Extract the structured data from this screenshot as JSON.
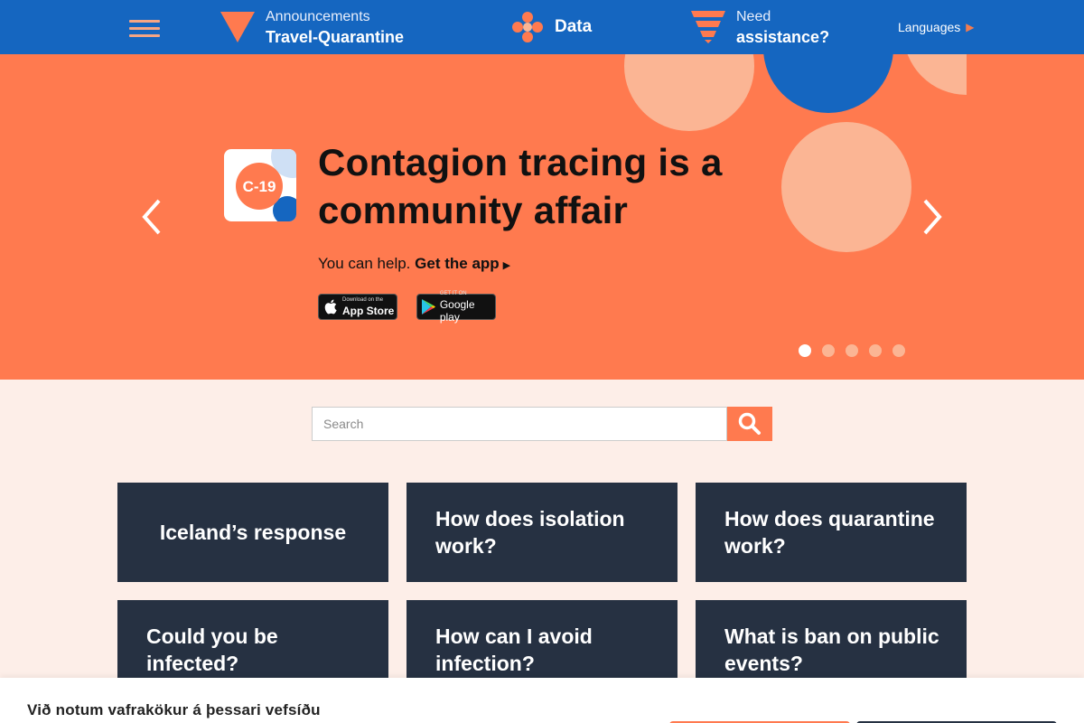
{
  "header": {
    "announcements": {
      "small": "Announcements",
      "bold": "Travel-Quarantine",
      "icon": "triangle-down-icon"
    },
    "data": {
      "bold": "Data",
      "icon": "data-flower-icon"
    },
    "need": {
      "small": "Need",
      "bold": "assistance?",
      "icon": "funnel-icon"
    },
    "languages": {
      "label": "Languages",
      "arrow": "▶"
    },
    "colors": {
      "bar": "#1566c0",
      "accent": "#f47c4e"
    }
  },
  "hero": {
    "app_tile_label": "C-19",
    "title": "Contagion tracing is a community affair",
    "help_text": "You can help.",
    "get_app": "Get the app",
    "get_app_arrow": "▶",
    "app_store": {
      "small": "Download on the",
      "large": "App Store"
    },
    "google_play": {
      "small": "GET IT ON",
      "large": "Google play"
    },
    "slides": 5,
    "active_slide": 1,
    "colors": {
      "background": "#ff7a4f",
      "light_circle": "#fbb594",
      "blue_circle": "#1566c0"
    }
  },
  "search": {
    "placeholder": "Search",
    "icon": "search-icon"
  },
  "cards": [
    {
      "label": "Iceland’s response"
    },
    {
      "label": "How does isolation work?"
    },
    {
      "label": "How does quarantine work?"
    },
    {
      "label": "Could you be infected?"
    },
    {
      "label": "How can I avoid infection?"
    },
    {
      "label": "What is ban on public events?"
    }
  ],
  "cookie": {
    "text": "Við notum vafrakökur á þessari vefsíðu"
  }
}
